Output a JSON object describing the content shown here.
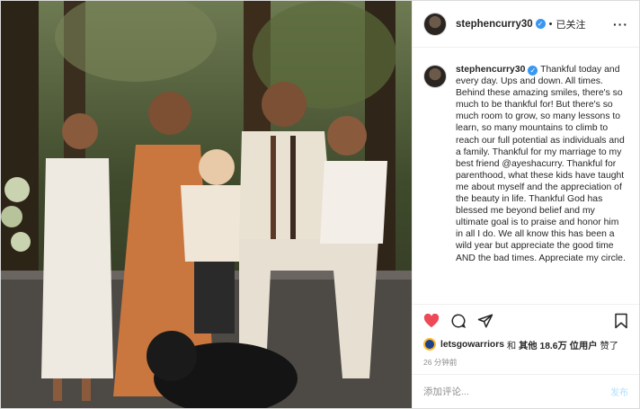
{
  "post": {
    "username": "stephencurry30",
    "follow_status": "已关注",
    "more_icon": "more-horizontal-icon",
    "caption_text": "Thankful today and every day. Ups and down. All times. Behind these amazing smiles, there's so much to be thankful for! But there's so much room to grow, so many lessons to learn, so many mountains to climb to reach our full potential as individuals and a family. Thankful for my marriage to my best friend @ayeshacurry. Thankful for parenthood, what these kids have taught me about myself and the appreciation of the beauty in life. Thankful God has blessed me beyond belief and my ultimate goal is to praise and honor him in all I do. We all know this has been a wild year but appreciate the good time AND the bad times. Appreciate my circle.",
    "likes": {
      "user": "letsgowarriors",
      "connector": "和",
      "others": "其他 18.6万 位用户",
      "suffix": "赞了"
    },
    "timestamp": "26 分钟前",
    "comment": {
      "placeholder": "添加评论...",
      "post_label": "发布"
    }
  },
  "colors": {
    "like_red": "#ed4956",
    "verified_blue": "#3897f0",
    "post_link_disabled": "#b2dffc"
  },
  "icons": [
    "heart-icon",
    "comment-icon",
    "share-icon",
    "save-icon",
    "verified-badge-icon"
  ]
}
